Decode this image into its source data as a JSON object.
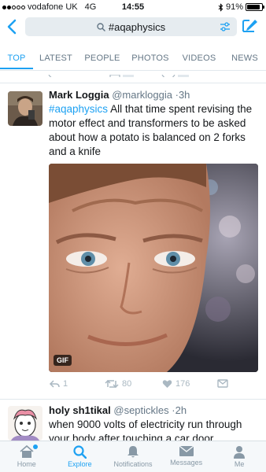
{
  "status_bar": {
    "carrier": "vodafone UK",
    "network": "4G",
    "time": "14:55",
    "battery": "91%",
    "battery_level": 0.91
  },
  "search": {
    "query": "#aqaphysics"
  },
  "tabs": [
    {
      "label": "TOP",
      "active": true
    },
    {
      "label": "LATEST",
      "active": false
    },
    {
      "label": "PEOPLE",
      "active": false
    },
    {
      "label": "PHOTOS",
      "active": false
    },
    {
      "label": "VIDEOS",
      "active": false
    },
    {
      "label": "NEWS",
      "active": false
    }
  ],
  "tweets": [
    {
      "name": "Mark Loggia",
      "handle": "@markloggia",
      "time": "3h",
      "hashtag": "#aqaphysics",
      "text": " All that time spent revising the motor effect and transformers to be asked about how a potato is balanced on 2 forks and a knife",
      "media_badge": "GIF",
      "replies": "1",
      "retweets": "80",
      "likes": "176"
    },
    {
      "name": "holy sh1tikal",
      "handle": "@septickles",
      "time": "2h",
      "text": "when 9000 volts of electricity run through your body after touching a car door"
    }
  ],
  "tabbar": [
    {
      "label": "Home",
      "icon": "home-icon",
      "active": false
    },
    {
      "label": "Explore",
      "icon": "search-icon",
      "active": true
    },
    {
      "label": "Notifications",
      "icon": "bell-icon",
      "active": false
    },
    {
      "label": "Messages",
      "icon": "envelope-icon",
      "active": false
    },
    {
      "label": "Me",
      "icon": "person-icon",
      "active": false
    }
  ],
  "colors": {
    "accent": "#1da1f2",
    "muted": "#657786",
    "icon_gray": "#aab8c2"
  }
}
